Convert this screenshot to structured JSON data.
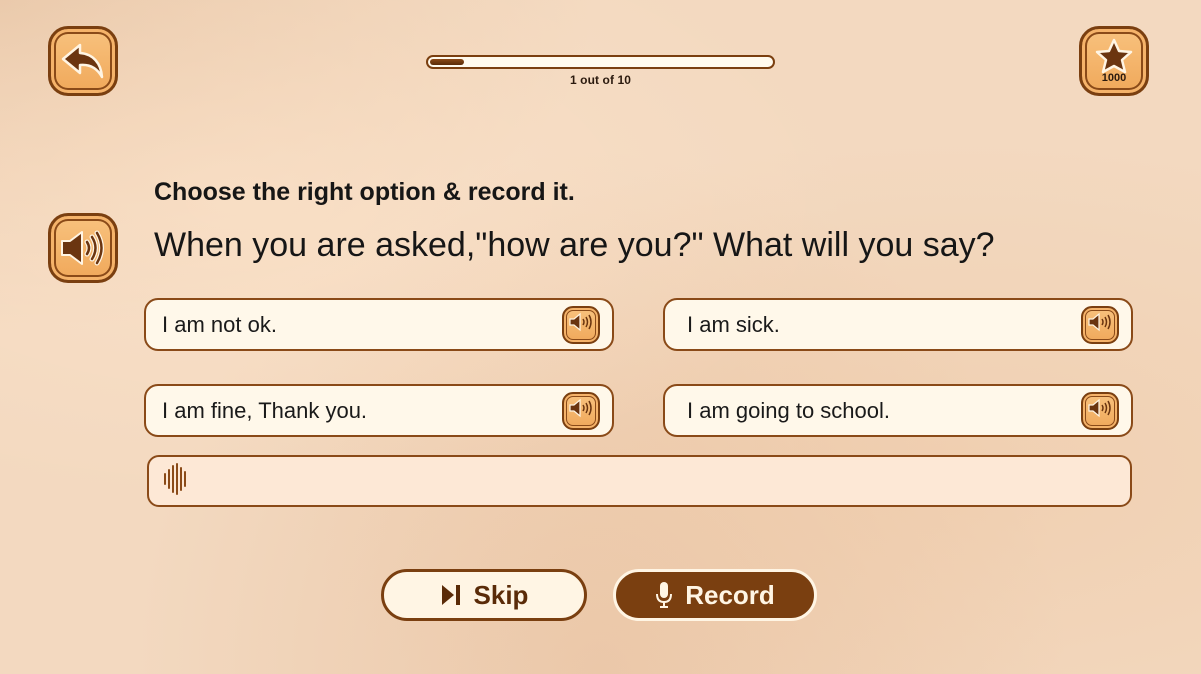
{
  "header": {
    "back_icon": "back-arrow-icon",
    "progress": {
      "current": 1,
      "total": 10,
      "fraction": 0.1,
      "label": "1 out of 10"
    },
    "score": {
      "icon": "star-icon",
      "value": "1000"
    }
  },
  "prompt": {
    "speaker_icon": "speaker-icon",
    "instruction": "Choose the right option & record it.",
    "question": "When you are asked,\"how are you?\" What will you say?"
  },
  "options": [
    {
      "text": "I am not ok.",
      "icon": "speaker-icon"
    },
    {
      "text": "I am sick.",
      "icon": "speaker-icon"
    },
    {
      "text": "I am fine, Thank you.",
      "icon": "speaker-icon"
    },
    {
      "text": "I am going to school.",
      "icon": "speaker-icon"
    }
  ],
  "recording": {
    "icon": "waveform-icon",
    "value": ""
  },
  "actions": {
    "skip_label": "Skip",
    "skip_icon": "skip-next-icon",
    "record_label": "Record",
    "record_icon": "microphone-icon"
  },
  "colors": {
    "accent_brown": "#7a3f10",
    "button_orange": "#f0a85a",
    "option_bg": "#fff8ea",
    "background": "#f3d9c0"
  }
}
